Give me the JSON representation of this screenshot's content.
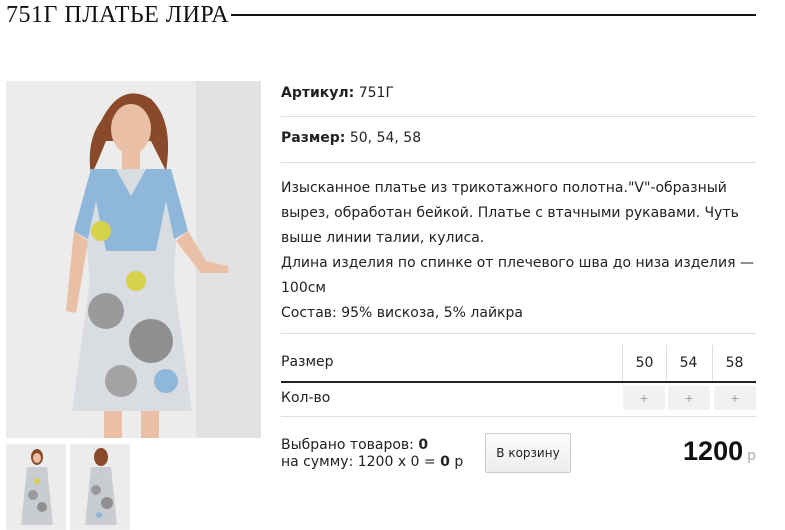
{
  "product": {
    "title": "751Г ПЛАТЬЕ ЛИРА",
    "article_label": "Артикул:",
    "article_value": "751Г",
    "size_label": "Размер:",
    "size_value": "50, 54, 58",
    "description": [
      "Изысканное платье из трикотажного полотна.\"V\"-образный",
      "вырез, обработан бейкой. Платье с втачными рукавами. Чуть",
      "выше линии талии, кулиса.",
      "Длина изделия по спинке от плечевого шва до низа изделия —",
      "100см",
      "Состав: 95% вискоза, 5% лайкра"
    ]
  },
  "size_table": {
    "size_header": "Размер",
    "qty_header": "Кол-во",
    "sizes": [
      "50",
      "54",
      "58"
    ],
    "qty_button": "+"
  },
  "summary": {
    "selected_label": "Выбрано товаров:",
    "selected_count": "0",
    "sum_label": "на сумму: 1200 х 0 =",
    "sum_value": "0",
    "sum_currency": "р"
  },
  "cart_button": "В корзину",
  "price": {
    "value": "1200",
    "currency": "р"
  },
  "colors": {
    "accent": "#222222",
    "dress_blue": "#8fb7d9",
    "dress_gray": "#9a9a9a",
    "dress_yellow": "#d6d34a",
    "hair": "#8a4a2a"
  }
}
